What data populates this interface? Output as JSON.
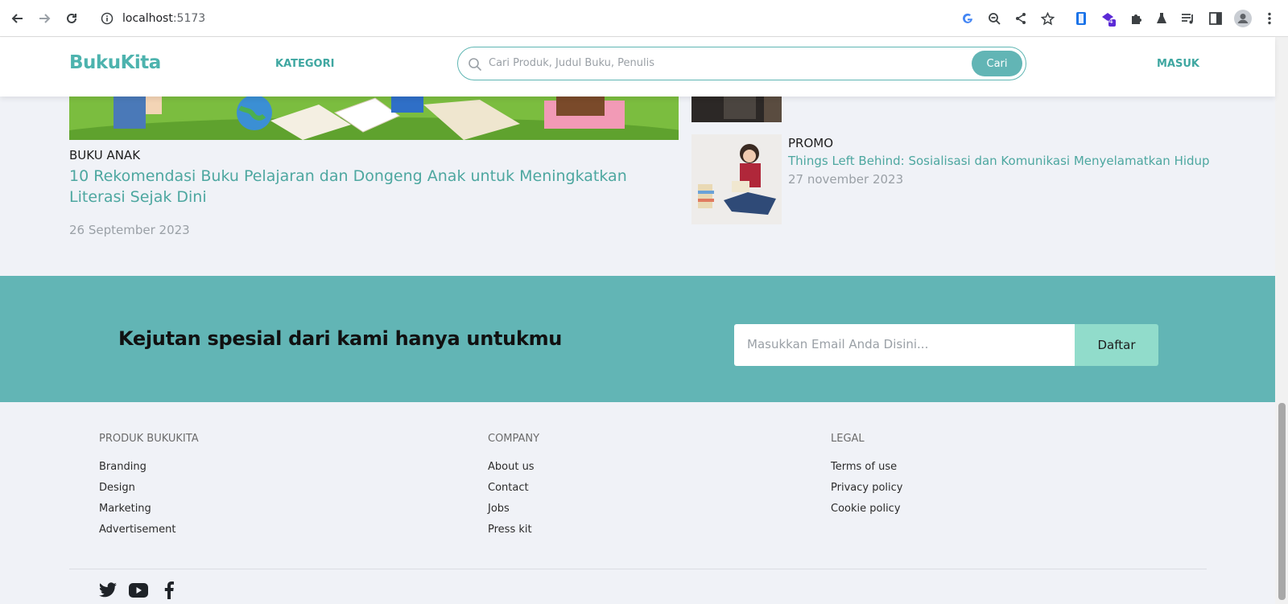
{
  "browser": {
    "url_host": "localhost",
    "url_port": ":5173",
    "extension_badge": "4",
    "icons": [
      "back-icon",
      "forward-icon",
      "reload-icon",
      "info-icon",
      "google-icon",
      "zoom-icon",
      "share-icon",
      "star-icon",
      "extension-icon",
      "puzzle-icon",
      "lab-icon",
      "media-icon",
      "sidepanel-icon",
      "profile-icon",
      "menu-icon"
    ]
  },
  "header": {
    "logo_part1": "Buku",
    "logo_part2": "Kita",
    "kategori": "KATEGORI",
    "search_placeholder": "Cari Produk, Judul Buku, Penulis",
    "search_button": "Cari",
    "masuk": "MASUK"
  },
  "featured": {
    "category": "BUKU ANAK",
    "title": "10 Rekomendasi Buku Pelajaran dan Dongeng Anak untuk Meningkatkan Literasi Sejak Dini",
    "date": "26 September 2023"
  },
  "side_article": {
    "category": "PROMO",
    "title": "Things Left Behind: Sosialisasi dan Komunikasi Menyelamatkan Hidup",
    "date": "27 november 2023"
  },
  "newsletter": {
    "heading": "Kejutan spesial dari kami hanya untukmu",
    "email_placeholder": "Masukkan Email Anda Disini...",
    "button": "Daftar"
  },
  "footer": {
    "columns": [
      {
        "title": "PRODUK BUKUKITA",
        "links": [
          "Branding",
          "Design",
          "Marketing",
          "Advertisement"
        ]
      },
      {
        "title": "COMPANY",
        "links": [
          "About us",
          "Contact",
          "Jobs",
          "Press kit"
        ]
      },
      {
        "title": "LEGAL",
        "links": [
          "Terms of use",
          "Privacy policy",
          "Cookie policy"
        ]
      }
    ],
    "social": [
      "twitter-icon",
      "youtube-icon",
      "facebook-icon"
    ]
  },
  "colors": {
    "brand_teal": "#4db3ae",
    "band_teal": "#62b5b5",
    "daftar_mint": "#91dccb",
    "page_bg": "#f0f2f7"
  }
}
